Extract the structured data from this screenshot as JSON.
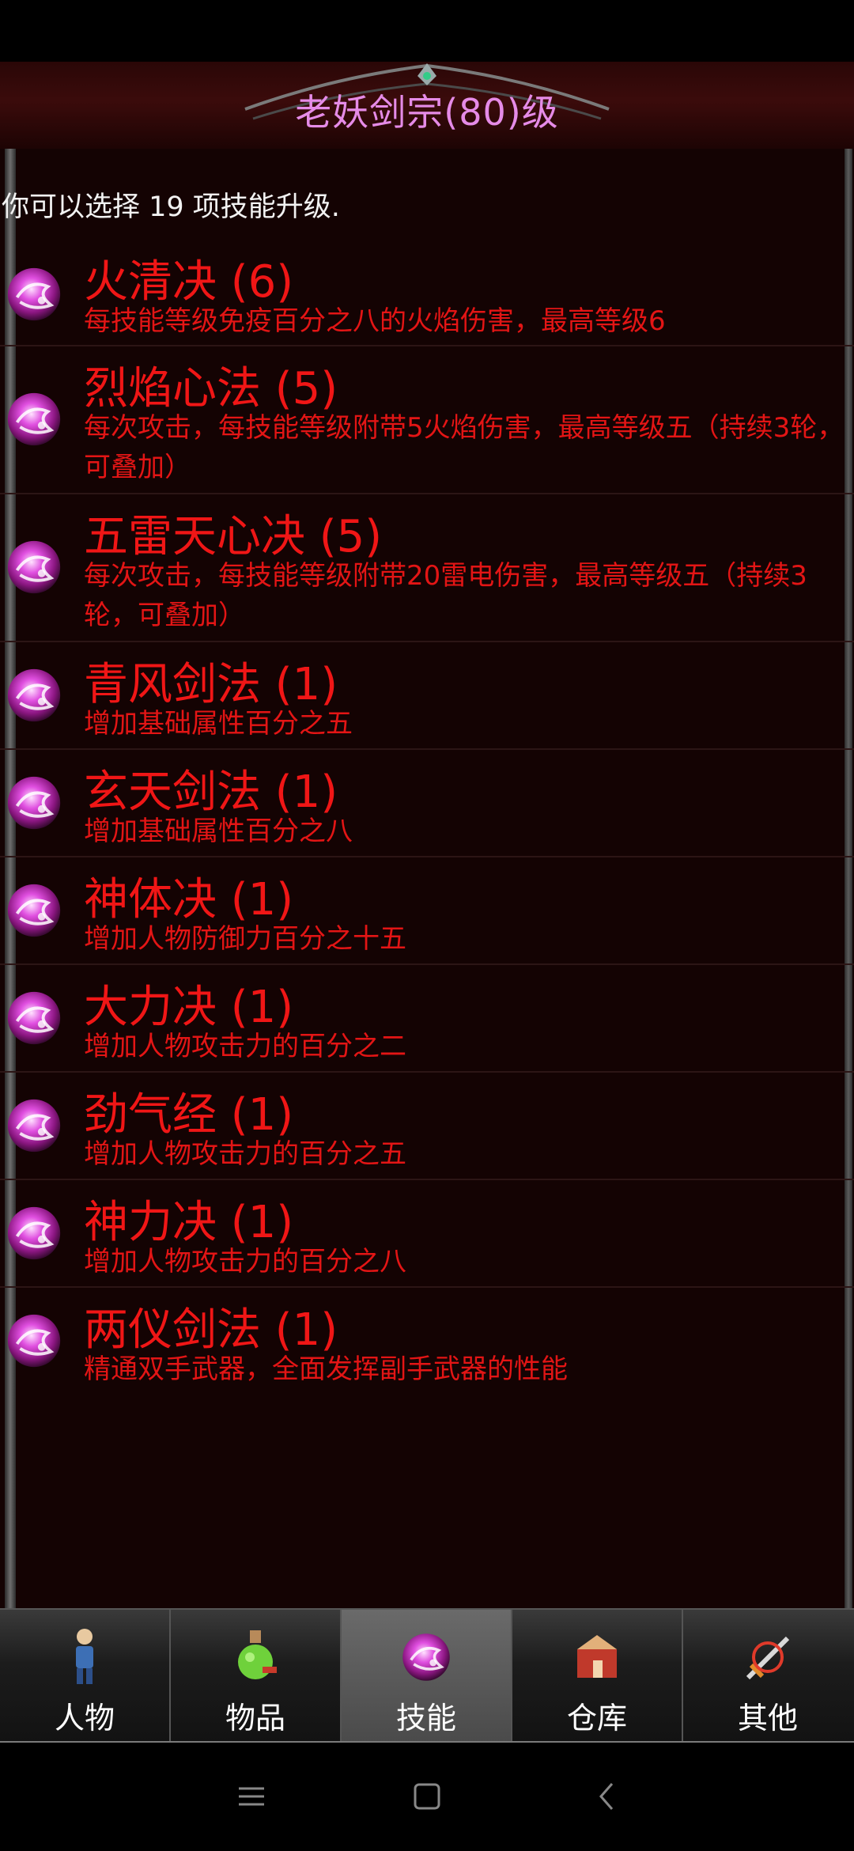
{
  "header": {
    "title": "老妖剑宗(80)级"
  },
  "info": {
    "points_text": "你可以选择 19 项技能升级."
  },
  "skills": [
    {
      "name": "火清决 (6)",
      "desc": "每技能等级免疫百分之八的火焰伤害，最高等级6",
      "icon": "skill-orb-icon"
    },
    {
      "name": "烈焰心法 (5)",
      "desc": "每次攻击，每技能等级附带5火焰伤害，最高等级五（持续3轮，可叠加）",
      "icon": "skill-orb-icon"
    },
    {
      "name": "五雷天心决 (5)",
      "desc": "每次攻击，每技能等级附带20雷电伤害，最高等级五（持续3轮，可叠加）",
      "icon": "skill-orb-icon"
    },
    {
      "name": "青风剑法 (1)",
      "desc": "增加基础属性百分之五",
      "icon": "skill-orb-icon"
    },
    {
      "name": "玄天剑法 (1)",
      "desc": "增加基础属性百分之八",
      "icon": "skill-orb-icon"
    },
    {
      "name": "神体决 (1)",
      "desc": "增加人物防御力百分之十五",
      "icon": "skill-orb-icon"
    },
    {
      "name": "大力决 (1)",
      "desc": "增加人物攻击力的百分之二",
      "icon": "skill-orb-icon"
    },
    {
      "name": "劲气经 (1)",
      "desc": "增加人物攻击力的百分之五",
      "icon": "skill-orb-icon"
    },
    {
      "name": "神力决 (1)",
      "desc": "增加人物攻击力的百分之八",
      "icon": "skill-orb-icon"
    },
    {
      "name": "两仪剑法 (1)",
      "desc": "精通双手武器，全面发挥副手武器的性能",
      "icon": "skill-orb-icon"
    }
  ],
  "nav": {
    "tabs": [
      {
        "label": "人物",
        "icon": "character-icon",
        "active": false
      },
      {
        "label": "物品",
        "icon": "potion-icon",
        "active": false
      },
      {
        "label": "技能",
        "icon": "skill-orb-icon",
        "active": true
      },
      {
        "label": "仓库",
        "icon": "warehouse-icon",
        "active": false
      },
      {
        "label": "其他",
        "icon": "sword-icon",
        "active": false
      }
    ]
  },
  "colors": {
    "title": "#e58be7",
    "skill_text": "#f01616",
    "panel_bg": "#140303"
  }
}
